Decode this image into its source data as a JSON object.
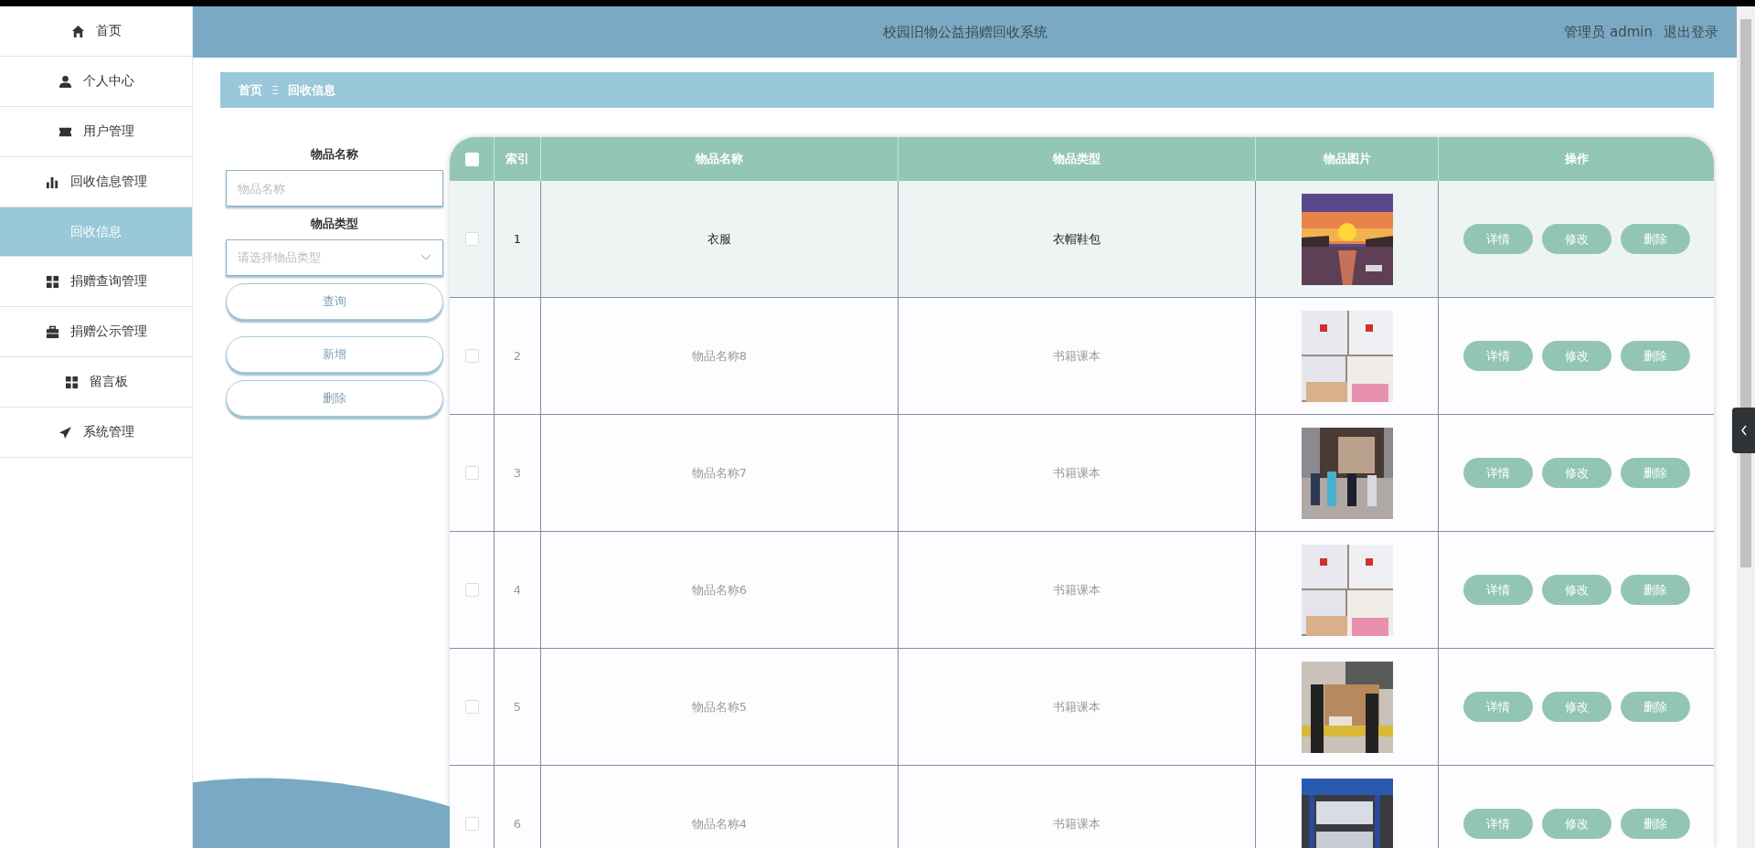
{
  "sidebar": {
    "items": [
      {
        "kind": "menu",
        "label": "首页",
        "selected": false
      },
      {
        "kind": "menu",
        "label": "个人中心",
        "selected": false
      },
      {
        "kind": "menu",
        "label": "用户管理",
        "selected": false
      },
      {
        "kind": "menu",
        "label": "回收信息管理",
        "selected": false
      },
      {
        "kind": "sub",
        "label": "回收信息",
        "selected": true
      },
      {
        "kind": "menu",
        "label": "捐赠查询管理",
        "selected": false
      },
      {
        "kind": "menu",
        "label": "捐赠公示管理",
        "selected": false
      },
      {
        "kind": "menu",
        "label": "留言板",
        "selected": false
      },
      {
        "kind": "menu",
        "label": "系统管理",
        "selected": false
      }
    ]
  },
  "header": {
    "title": "校园旧物公益捐赠回收系统",
    "user": "管理员 admin",
    "logout": "退出登录"
  },
  "breadcrumb": {
    "home": "首页",
    "separator": "Ξ",
    "current": "回收信息"
  },
  "search_form": {
    "name_label": "物品名称",
    "name_placeholder": "物品名称",
    "type_label": "物品类型",
    "type_placeholder": "请选择物品类型",
    "query_button": "查询",
    "add_button": "新增",
    "delete_button": "删除"
  },
  "table": {
    "columns": [
      "索引",
      "物品名称",
      "物品类型",
      "物品图片",
      "操作"
    ],
    "select_all_checked": false,
    "rows": [
      {
        "index": "1",
        "name": "衣服",
        "type": "衣帽鞋包",
        "checked": false,
        "hovered": true,
        "actions": [
          "详情",
          "修改",
          "删除"
        ]
      },
      {
        "index": "2",
        "name": "物品名称8",
        "type": "书籍课本",
        "checked": false,
        "hovered": false,
        "actions": [
          "详情",
          "修改",
          "删除"
        ]
      },
      {
        "index": "3",
        "name": "物品名称7",
        "type": "书籍课本",
        "checked": false,
        "hovered": false,
        "actions": [
          "详情",
          "修改",
          "删除"
        ]
      },
      {
        "index": "4",
        "name": "物品名称6",
        "type": "书籍课本",
        "checked": false,
        "hovered": false,
        "actions": [
          "详情",
          "修改",
          "删除"
        ]
      },
      {
        "index": "5",
        "name": "物品名称5",
        "type": "书籍课本",
        "checked": false,
        "hovered": false,
        "actions": [
          "详情",
          "修改",
          "删除"
        ]
      },
      {
        "index": "6",
        "name": "物品名称4",
        "type": "书籍课本",
        "checked": false,
        "hovered": false,
        "actions": [
          "详情",
          "修改",
          "删除"
        ]
      }
    ]
  }
}
